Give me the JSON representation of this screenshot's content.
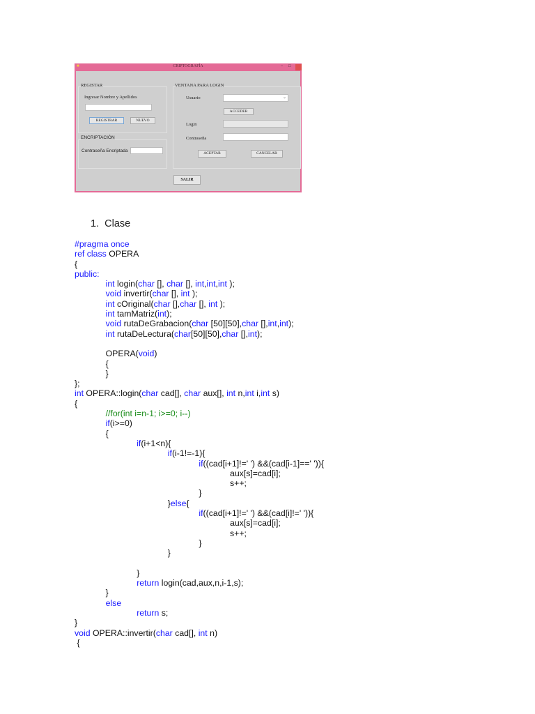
{
  "dialog": {
    "title": "CRIPTOGRAFÍA",
    "registar": {
      "legend": "REGISTAR",
      "name_label": "Ingresar Nombre y Apellidos",
      "name_value": "",
      "registrar_btn": "REGISTRAR",
      "nuevo_btn": "NUEVO"
    },
    "encriptacion": {
      "legend": "ENCRIPTACIÓN",
      "label": "Contraseña Encriptada",
      "value": ""
    },
    "login": {
      "legend": "VENTANA PARA LOGIN",
      "usuario_label": "Usuario",
      "usuario_value": "",
      "acceder_btn": "ACCEDER",
      "login_label": "Login",
      "login_value": "",
      "password_label": "Contraseña",
      "password_value": "",
      "aceptar_btn": "ACEPTAR",
      "cancelar_btn": "CANCELAR"
    },
    "salir_btn": "SALIR"
  },
  "list": {
    "number": "1.",
    "label": "Clase"
  },
  "code": [
    {
      "i": 0,
      "s": [
        [
          "#pragma once",
          "k"
        ]
      ]
    },
    {
      "i": 0,
      "s": [
        [
          "ref class",
          "k"
        ],
        [
          " OPERA",
          ""
        ]
      ]
    },
    {
      "i": 0,
      "s": [
        [
          "{",
          ""
        ]
      ]
    },
    {
      "i": 0,
      "s": [
        [
          "public:",
          "k"
        ]
      ]
    },
    {
      "i": 1,
      "s": [
        [
          "int",
          "k"
        ],
        [
          " login(",
          ""
        ],
        [
          "char",
          "k"
        ],
        [
          " [], ",
          ""
        ],
        [
          "char",
          "k"
        ],
        [
          " [], ",
          ""
        ],
        [
          "int",
          "k"
        ],
        [
          ",",
          ""
        ],
        [
          "int",
          "k"
        ],
        [
          ",",
          ""
        ],
        [
          "int",
          "k"
        ],
        [
          " );",
          ""
        ]
      ]
    },
    {
      "i": 1,
      "s": [
        [
          "void",
          "k"
        ],
        [
          " invertir(",
          ""
        ],
        [
          "char",
          "k"
        ],
        [
          " [], ",
          ""
        ],
        [
          "int",
          "k"
        ],
        [
          " );",
          ""
        ]
      ]
    },
    {
      "i": 1,
      "s": [
        [
          "int",
          "k"
        ],
        [
          " cOriginal(",
          ""
        ],
        [
          "char",
          "k"
        ],
        [
          " [],",
          ""
        ],
        [
          "char",
          "k"
        ],
        [
          " [], ",
          ""
        ],
        [
          "int",
          "k"
        ],
        [
          " );",
          ""
        ]
      ]
    },
    {
      "i": 1,
      "s": [
        [
          "int",
          "k"
        ],
        [
          " tamMatriz(",
          ""
        ],
        [
          "int",
          "k"
        ],
        [
          ");",
          ""
        ]
      ]
    },
    {
      "i": 1,
      "s": [
        [
          "void",
          "k"
        ],
        [
          " rutaDeGrabacion(",
          ""
        ],
        [
          "char",
          "k"
        ],
        [
          " [50][50],",
          ""
        ],
        [
          "char",
          "k"
        ],
        [
          " [],",
          ""
        ],
        [
          "int",
          "k"
        ],
        [
          ",",
          ""
        ],
        [
          "int",
          "k"
        ],
        [
          ");",
          ""
        ]
      ]
    },
    {
      "i": 1,
      "s": [
        [
          "int",
          "k"
        ],
        [
          " rutaDeLectura(",
          ""
        ],
        [
          "char",
          "k"
        ],
        [
          "[50][50],",
          ""
        ],
        [
          "char",
          "k"
        ],
        [
          " [],",
          ""
        ],
        [
          "int",
          "k"
        ],
        [
          ");",
          ""
        ]
      ]
    },
    {
      "i": 0,
      "s": []
    },
    {
      "i": 1,
      "s": [
        [
          "OPERA(",
          ""
        ],
        [
          "void",
          "k"
        ],
        [
          ")",
          ""
        ]
      ]
    },
    {
      "i": 1,
      "s": [
        [
          "{",
          ""
        ]
      ]
    },
    {
      "i": 1,
      "s": [
        [
          "}",
          ""
        ]
      ]
    },
    {
      "i": 0,
      "s": [
        [
          "};",
          ""
        ]
      ]
    },
    {
      "i": 0,
      "s": [
        [
          "int",
          "k"
        ],
        [
          " OPERA::login(",
          ""
        ],
        [
          "char",
          "k"
        ],
        [
          " cad[], ",
          ""
        ],
        [
          "char",
          "k"
        ],
        [
          " aux[], ",
          ""
        ],
        [
          "int",
          "k"
        ],
        [
          " n,",
          ""
        ],
        [
          "int",
          "k"
        ],
        [
          " i,",
          ""
        ],
        [
          "int",
          "k"
        ],
        [
          " s)",
          ""
        ]
      ]
    },
    {
      "i": 0,
      "s": [
        [
          "{",
          ""
        ]
      ]
    },
    {
      "i": 1,
      "s": [
        [
          "//for(int i=n-1; i>=0; i--)",
          "c"
        ]
      ]
    },
    {
      "i": 1,
      "s": [
        [
          "if",
          "k"
        ],
        [
          "(i>=0)",
          ""
        ]
      ]
    },
    {
      "i": 1,
      "s": [
        [
          "{",
          ""
        ]
      ]
    },
    {
      "i": 2,
      "s": [
        [
          "if",
          "k"
        ],
        [
          "(i+1<n){",
          ""
        ]
      ]
    },
    {
      "i": 3,
      "s": [
        [
          "if",
          "k"
        ],
        [
          "(i-1!=-1){",
          ""
        ]
      ]
    },
    {
      "i": 4,
      "s": [
        [
          "if",
          "k"
        ],
        [
          "((cad[i+1]!=' ') &&(cad[i-1]==' ')){",
          ""
        ]
      ]
    },
    {
      "i": 5,
      "s": [
        [
          "aux[s]=cad[i];",
          ""
        ]
      ]
    },
    {
      "i": 5,
      "s": [
        [
          "s++;",
          ""
        ]
      ]
    },
    {
      "i": 4,
      "s": [
        [
          "}",
          ""
        ]
      ]
    },
    {
      "i": 3,
      "s": [
        [
          "}",
          ""
        ],
        [
          "else",
          "k"
        ],
        [
          "{",
          ""
        ]
      ]
    },
    {
      "i": 4,
      "s": [
        [
          "if",
          "k"
        ],
        [
          "((cad[i+1]!=' ') &&(cad[i]!=' ')){",
          ""
        ]
      ]
    },
    {
      "i": 5,
      "s": [
        [
          "aux[s]=cad[i];",
          ""
        ]
      ]
    },
    {
      "i": 5,
      "s": [
        [
          "s++;",
          ""
        ]
      ]
    },
    {
      "i": 4,
      "s": [
        [
          "}",
          ""
        ]
      ]
    },
    {
      "i": 3,
      "s": [
        [
          "}",
          ""
        ]
      ]
    },
    {
      "i": 0,
      "s": []
    },
    {
      "i": 2,
      "s": [
        [
          "}",
          ""
        ]
      ]
    },
    {
      "i": 2,
      "s": [
        [
          "return",
          "k"
        ],
        [
          " login(cad,aux,n,i-1,s);",
          ""
        ]
      ]
    },
    {
      "i": 1,
      "s": [
        [
          "}",
          ""
        ]
      ]
    },
    {
      "i": 1,
      "s": [
        [
          "else",
          "k"
        ]
      ]
    },
    {
      "i": 2,
      "s": [
        [
          "return",
          "k"
        ],
        [
          " s;",
          ""
        ]
      ]
    },
    {
      "i": 0,
      "s": [
        [
          "}",
          ""
        ]
      ]
    },
    {
      "i": 0,
      "s": [
        [
          "void",
          "k"
        ],
        [
          " OPERA::invertir(",
          ""
        ],
        [
          "char",
          "k"
        ],
        [
          " cad[], ",
          ""
        ],
        [
          "int",
          "k"
        ],
        [
          " n)",
          ""
        ]
      ]
    },
    {
      "i": 0,
      "s": [
        [
          " {",
          ""
        ]
      ]
    }
  ]
}
